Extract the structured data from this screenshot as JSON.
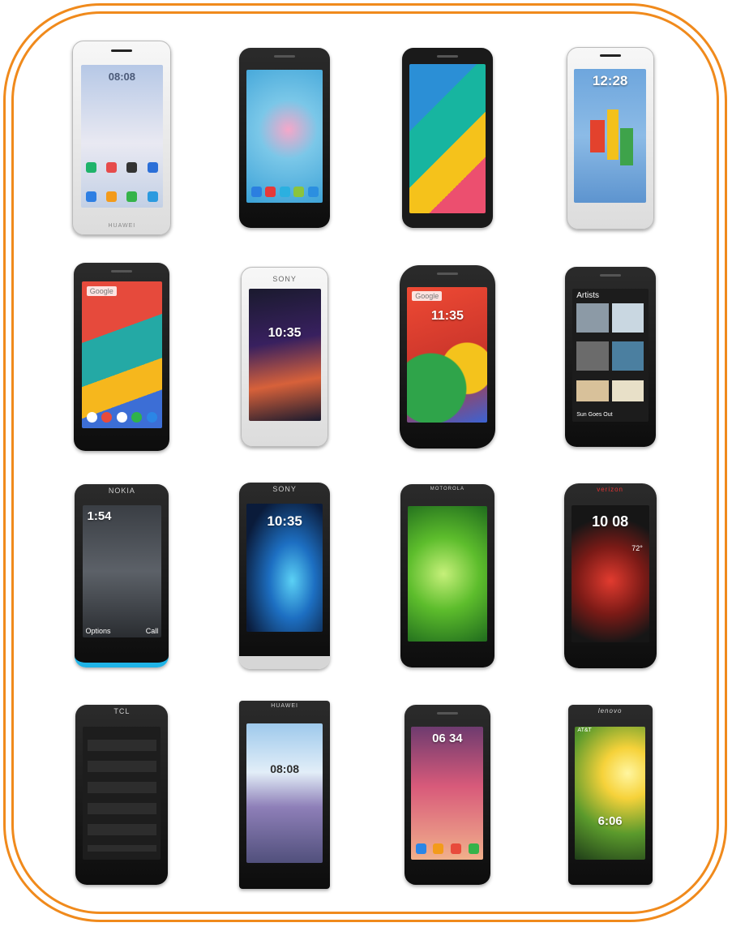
{
  "phones": [
    {
      "brand": "HUAWEI",
      "clock": "08:08",
      "labels": []
    },
    {
      "brand": "",
      "clock": "",
      "labels": []
    },
    {
      "brand": "",
      "clock": "",
      "labels": []
    },
    {
      "brand": "",
      "clock": "12:28",
      "labels": []
    },
    {
      "brand": "",
      "clock": "",
      "labels": [
        "Google"
      ]
    },
    {
      "brand": "SONY",
      "clock": "10:35",
      "labels": []
    },
    {
      "brand": "",
      "clock": "11:35",
      "labels": [
        "Google"
      ]
    },
    {
      "brand": "",
      "clock": "",
      "labels": [
        "Artists",
        "Sun Goes Out"
      ]
    },
    {
      "brand": "NOKIA",
      "clock": "1:54",
      "labels": [
        "Options",
        "Call"
      ]
    },
    {
      "brand": "SONY",
      "clock": "10:35",
      "labels": []
    },
    {
      "brand": "MOTOROLA",
      "clock": "",
      "labels": []
    },
    {
      "brand": "verizon",
      "clock": "10 08",
      "labels": [
        "72°"
      ]
    },
    {
      "brand": "TCL",
      "clock": "",
      "labels": []
    },
    {
      "brand": "HUAWEI",
      "clock": "08:08",
      "labels": []
    },
    {
      "brand": "",
      "clock": "06 34",
      "labels": []
    },
    {
      "brand": "lenovo",
      "clock": "6:06",
      "labels": [
        "AT&T"
      ]
    }
  ]
}
